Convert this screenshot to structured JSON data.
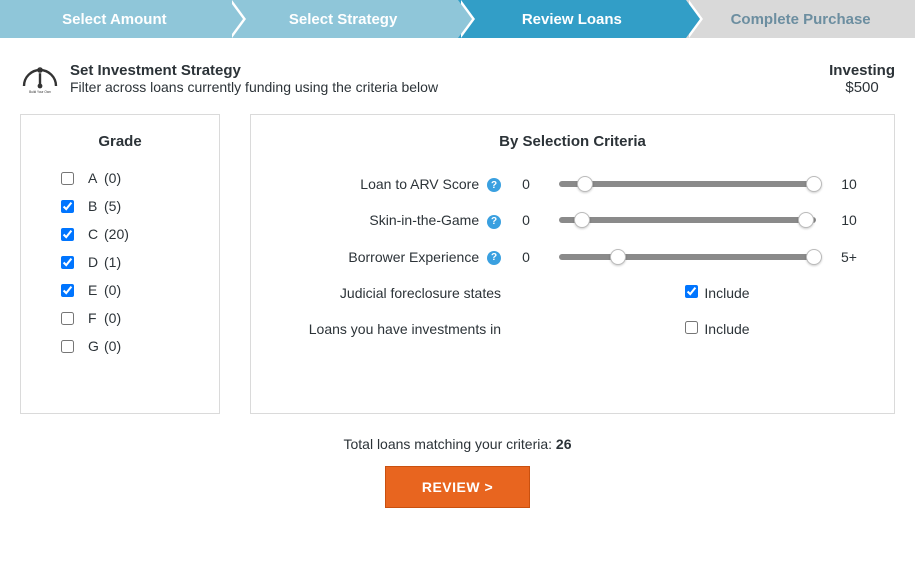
{
  "steps": [
    "Select Amount",
    "Select Strategy",
    "Review Loans",
    "Complete Purchase"
  ],
  "header": {
    "title": "Set Investment Strategy",
    "subtitle": "Filter across loans currently funding using the criteria below",
    "gauge_caption": "Build Your Own"
  },
  "investing": {
    "label": "Investing",
    "amount": "$500"
  },
  "grade": {
    "title": "Grade",
    "items": [
      {
        "letter": "A",
        "count": "(0)",
        "checked": false
      },
      {
        "letter": "B",
        "count": "(5)",
        "checked": true
      },
      {
        "letter": "C",
        "count": "(20)",
        "checked": true
      },
      {
        "letter": "D",
        "count": "(1)",
        "checked": true
      },
      {
        "letter": "E",
        "count": "(0)",
        "checked": true
      },
      {
        "letter": "F",
        "count": "(0)",
        "checked": false
      },
      {
        "letter": "G",
        "count": "(0)",
        "checked": false
      }
    ]
  },
  "criteria": {
    "title": "By Selection Criteria",
    "sliders": [
      {
        "label": "Loan to ARV Score",
        "help": true,
        "min": "0",
        "max": "10",
        "lo": 7,
        "hi": 96
      },
      {
        "label": "Skin-in-the-Game",
        "help": true,
        "min": "0",
        "max": "10",
        "lo": 6,
        "hi": 93
      },
      {
        "label": "Borrower Experience",
        "help": true,
        "min": "0",
        "max": "5+",
        "lo": 20,
        "hi": 96
      }
    ],
    "checks": [
      {
        "label": "Judicial foreclosure states",
        "text": "Include",
        "checked": true
      },
      {
        "label": "Loans you have investments in",
        "text": "Include",
        "checked": false
      }
    ]
  },
  "footer": {
    "match_prefix": "Total loans matching your criteria: ",
    "match_count": "26",
    "button": "REVIEW >"
  }
}
